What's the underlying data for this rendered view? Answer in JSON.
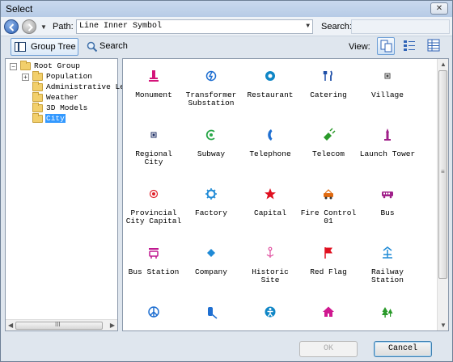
{
  "window": {
    "title": "Select",
    "close_glyph": "✕"
  },
  "pathbar": {
    "path_label": "Path:",
    "path_value": "Line Inner Symbol",
    "search_label": "Search:",
    "search_value": ""
  },
  "toolbar": {
    "group_tree_label": "Group Tree",
    "search_label": "Search",
    "view_label": "View:",
    "active_view": "large-icons"
  },
  "tree": {
    "items": [
      {
        "label": "Root Group",
        "level": 0,
        "expander": "−",
        "selected": false
      },
      {
        "label": "Population",
        "level": 1,
        "expander": "+",
        "selected": false
      },
      {
        "label": "Administrative Lev",
        "level": 1,
        "expander": "",
        "selected": false
      },
      {
        "label": "Weather",
        "level": 1,
        "expander": "",
        "selected": false
      },
      {
        "label": "3D Models",
        "level": 1,
        "expander": "",
        "selected": false
      },
      {
        "label": "City",
        "level": 1,
        "expander": "",
        "selected": true
      }
    ],
    "scroll_thumb_glyph": "III"
  },
  "symbols": [
    {
      "label": "Monument",
      "icon": "monument-icon",
      "color": "#d4147a"
    },
    {
      "label": "Transformer\nSubstation",
      "icon": "lightning-icon",
      "color": "#1f6fd1"
    },
    {
      "label": "Restaurant",
      "icon": "restaurant-icon",
      "color": "#0f86c6"
    },
    {
      "label": "Catering",
      "icon": "fork-knife-icon",
      "color": "#1f4fa8"
    },
    {
      "label": "Village",
      "icon": "square-dot-icon",
      "color": "#444444"
    },
    {
      "label": "Regional City",
      "icon": "square-dot-icon",
      "color": "#1f2f66"
    },
    {
      "label": "Subway",
      "icon": "subway-icon",
      "color": "#2aa84a"
    },
    {
      "label": "Telephone",
      "icon": "phone-icon",
      "color": "#1f6fd1"
    },
    {
      "label": "Telecom",
      "icon": "satellite-icon",
      "color": "#2a9a2a"
    },
    {
      "label": "Launch Tower",
      "icon": "tower-icon",
      "color": "#a0208a"
    },
    {
      "label": "Provincial\nCity Capital",
      "icon": "target-icon",
      "color": "#e0202a"
    },
    {
      "label": "Factory",
      "icon": "gear-icon",
      "color": "#1f8ad6"
    },
    {
      "label": "Capital",
      "icon": "star-icon",
      "color": "#e01020"
    },
    {
      "label": "Fire Control\n01",
      "icon": "fire-truck-icon",
      "color": "#e06a10"
    },
    {
      "label": "Bus",
      "icon": "bus-icon",
      "color": "#a0208a"
    },
    {
      "label": "Bus Station",
      "icon": "bus-station-icon",
      "color": "#c01890"
    },
    {
      "label": "Company",
      "icon": "diamond-icon",
      "color": "#1f8ad6"
    },
    {
      "label": "Historic Site",
      "icon": "historic-icon",
      "color": "#e050a0"
    },
    {
      "label": "Red Flag",
      "icon": "flag-icon",
      "color": "#e01020"
    },
    {
      "label": "Railway\nStation",
      "icon": "railway-icon",
      "color": "#1f8ad6"
    },
    {
      "label": "",
      "icon": "peace-icon",
      "color": "#1f6fd1"
    },
    {
      "label": "",
      "icon": "extinguisher-icon",
      "color": "#1f6fd1"
    },
    {
      "label": "",
      "icon": "person-circle-icon",
      "color": "#0f86c6"
    },
    {
      "label": "",
      "icon": "house-icon",
      "color": "#d01890"
    },
    {
      "label": "",
      "icon": "forest-icon",
      "color": "#2a9a2a"
    }
  ],
  "footer": {
    "ok_label": "OK",
    "cancel_label": "Cancel"
  }
}
